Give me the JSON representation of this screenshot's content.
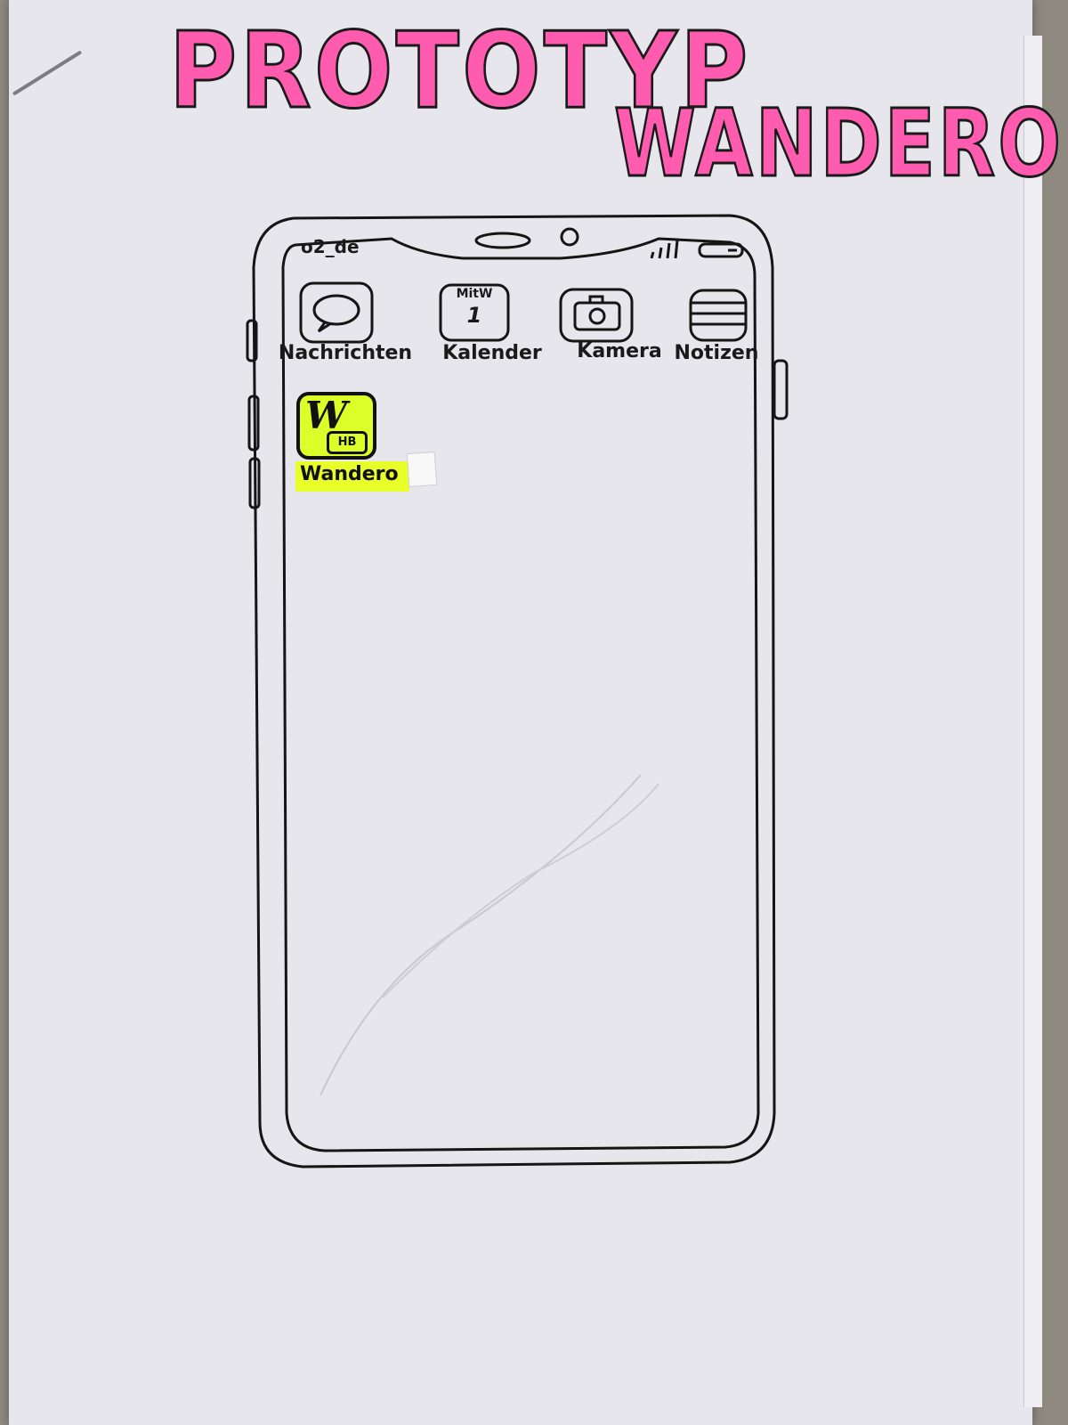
{
  "sheet": {
    "title_line1": "PROTOTYP",
    "title_line2": "WANDERO",
    "title_color": "#ff5cb0"
  },
  "phone": {
    "status_bar": {
      "carrier": "o2_de",
      "signal_icon": "signal-bars-icon",
      "battery_icon": "battery-icon"
    },
    "apps": [
      {
        "label": "Nachrichten",
        "icon": "chat-bubble-icon"
      },
      {
        "label": "Kalender",
        "icon": "calendar-icon",
        "icon_day": "MitW",
        "icon_date": "1"
      },
      {
        "label": "Kamera",
        "icon": "camera-icon"
      },
      {
        "label": "Notizen",
        "icon": "notes-icon"
      }
    ],
    "featured_app": {
      "label": "Wandero",
      "icon": "wandero-logo-icon",
      "logo_letter": "W",
      "logo_badge": "HB",
      "highlight_color": "#dcff2a"
    }
  }
}
